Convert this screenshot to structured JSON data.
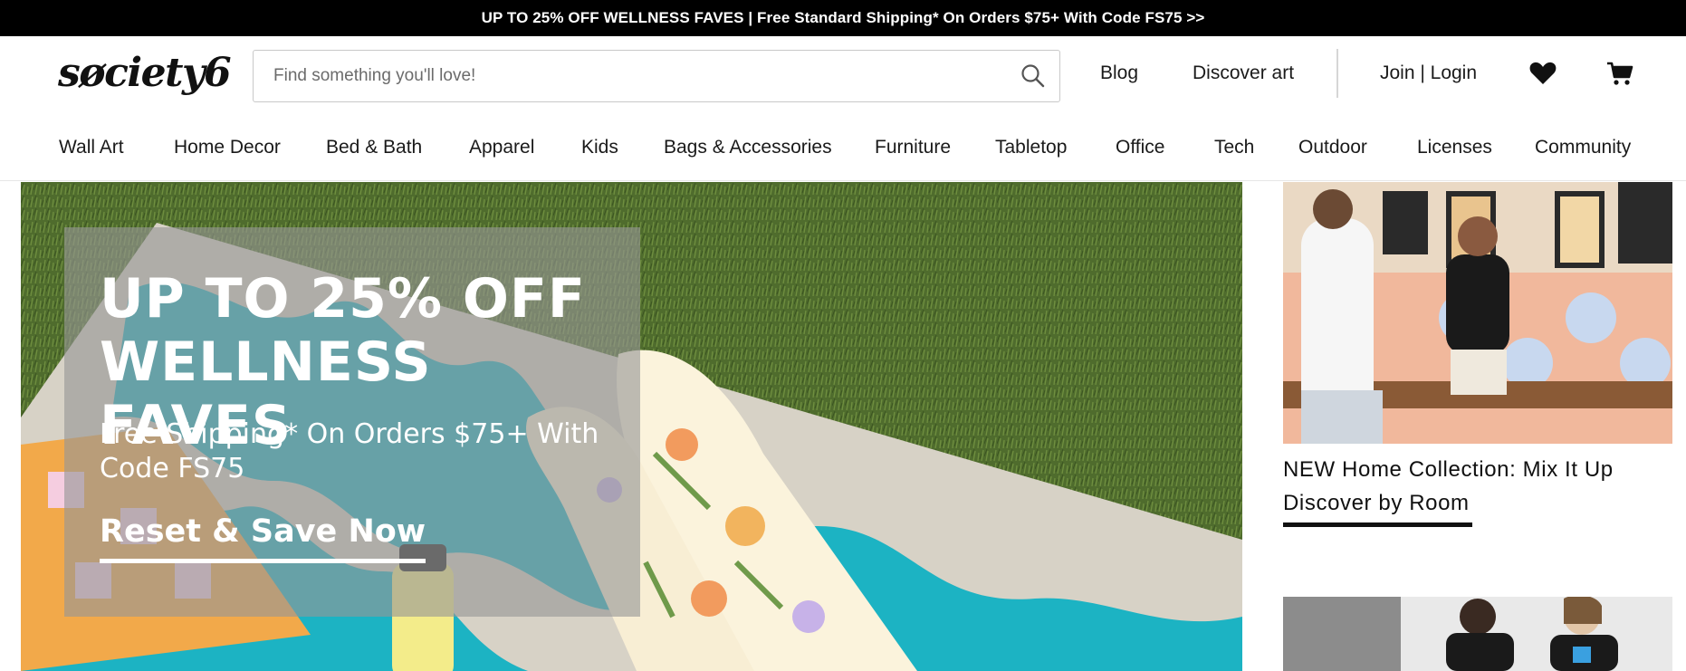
{
  "promo_bar": {
    "text": "UP TO 25% OFF WELLNESS FAVES | Free Standard Shipping* On Orders $75+ With Code FS75 >>"
  },
  "header": {
    "logo": "søciety6",
    "search": {
      "placeholder": "Find something you'll love!",
      "value": ""
    },
    "links": {
      "blog": "Blog",
      "discover_art": "Discover art",
      "join_login": "Join | Login"
    },
    "icons": {
      "search": "search-icon",
      "wishlist": "heart-icon",
      "cart": "cart-icon"
    }
  },
  "categories": [
    "Wall Art",
    "Home Decor",
    "Bed & Bath",
    "Apparel",
    "Kids",
    "Bags & Accessories",
    "Furniture",
    "Tabletop",
    "Office",
    "Tech",
    "Outdoor",
    "Licenses",
    "Community"
  ],
  "hero": {
    "title_line1": "UP TO 25% OFF",
    "title_line2": "WELLNESS FAVES",
    "subtitle": "Free Shipping* On Orders $75+ With Code FS75",
    "cta": "Reset & Save Now"
  },
  "side_feature": {
    "caption_line1": "NEW Home Collection: Mix It Up",
    "caption_line2": "Discover by Room"
  },
  "colors": {
    "promo_bg": "#000000",
    "promo_text": "#ffffff",
    "grass": "#4e6b2c",
    "mat_teal": "#1fb4c4",
    "accent_dark": "#111111"
  }
}
